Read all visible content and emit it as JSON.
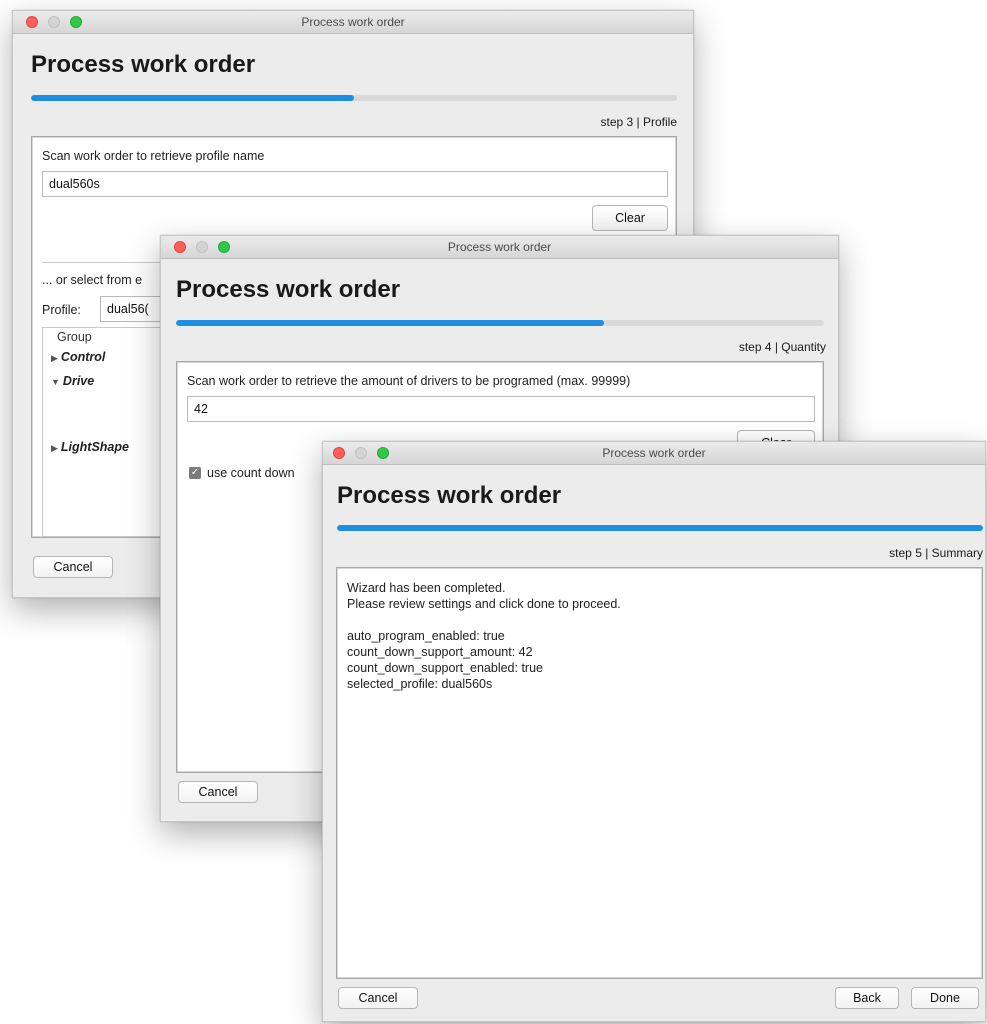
{
  "window1": {
    "title": "Process work order",
    "heading": "Process work order",
    "progress": 0.5,
    "step": "step 3 | Profile",
    "scan_label": "Scan work order to retrieve profile name",
    "scan_value": "dual560s",
    "clear_label": "Clear",
    "or_select_label": "... or select from e",
    "profile_label": "Profile:",
    "profile_value": "dual56(",
    "group_header": "Group",
    "groups": [
      "Control",
      "Drive",
      "LightShape"
    ],
    "cancel_label": "Cancel"
  },
  "window2": {
    "title": "Process work order",
    "heading": "Process work order",
    "progress": 0.66,
    "step": "step 4 | Quantity",
    "scan_label": "Scan work order to retrieve the amount of drivers to be programed (max. 99999)",
    "scan_value": "42",
    "clear_label": "Clear",
    "use_countdown_label": "use count down",
    "use_countdown_checked": true,
    "cancel_label": "Cancel"
  },
  "window3": {
    "title": "Process work order",
    "heading": "Process work order",
    "progress": 1.0,
    "step": "step 5 | Summary",
    "summary_lines": [
      "Wizard has been completed.",
      "Please review settings and click done to proceed.",
      "",
      "auto_program_enabled: true",
      "count_down_support_amount: 42",
      "count_down_support_enabled: true",
      "selected_profile: dual560s"
    ],
    "cancel_label": "Cancel",
    "back_label": "Back",
    "done_label": "Done"
  },
  "colors": {
    "accent": "#1e8ee3",
    "close": "#fc5f57",
    "zoom": "#34c84a"
  }
}
